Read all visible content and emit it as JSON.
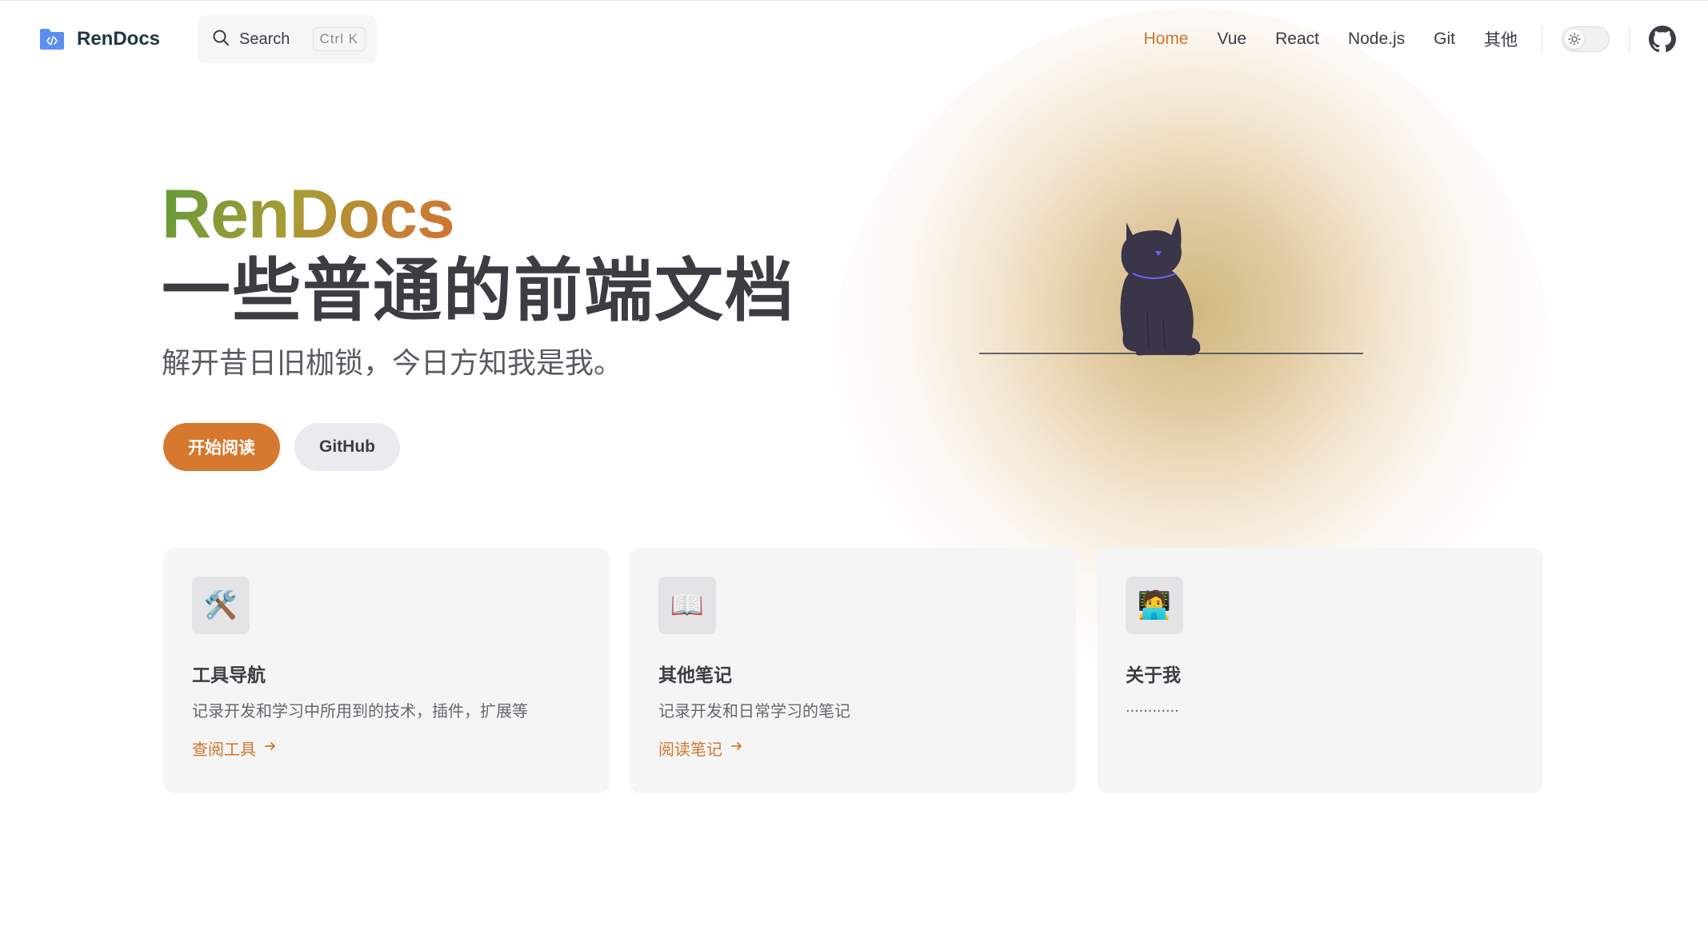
{
  "nav": {
    "brand": "RenDocs",
    "search": {
      "label": "Search",
      "shortcut": "Ctrl K"
    },
    "menu": [
      "Home",
      "Vue",
      "React",
      "Node.js",
      "Git",
      "其他"
    ],
    "active_menu": "Home",
    "icons": {
      "logo": "code-folder-icon",
      "search": "search-icon",
      "theme": "sun-icon",
      "github": "github-icon"
    }
  },
  "hero": {
    "name": "RenDocs",
    "text": "一些普通的前端文档",
    "tagline": "解开昔日旧枷锁，今日方知我是我。",
    "actions": {
      "primary": "开始阅读",
      "secondary": "GitHub"
    },
    "image": "cat-illustration"
  },
  "features": [
    {
      "icon": "🛠️",
      "icon_name": "tools-icon",
      "title": "工具导航",
      "details": "记录开发和学习中所用到的技术，插件，扩展等",
      "link": "查阅工具"
    },
    {
      "icon": "📖",
      "icon_name": "book-icon",
      "title": "其他笔记",
      "details": "记录开发和日常学习的笔记",
      "link": "阅读笔记"
    },
    {
      "icon": "🧑‍💻",
      "icon_name": "developer-icon",
      "title": "关于我",
      "details": "............",
      "link": ""
    }
  ],
  "colors": {
    "brand": "#d6792e",
    "text": "#3c3c43",
    "card_bg": "#f5f5f6"
  }
}
